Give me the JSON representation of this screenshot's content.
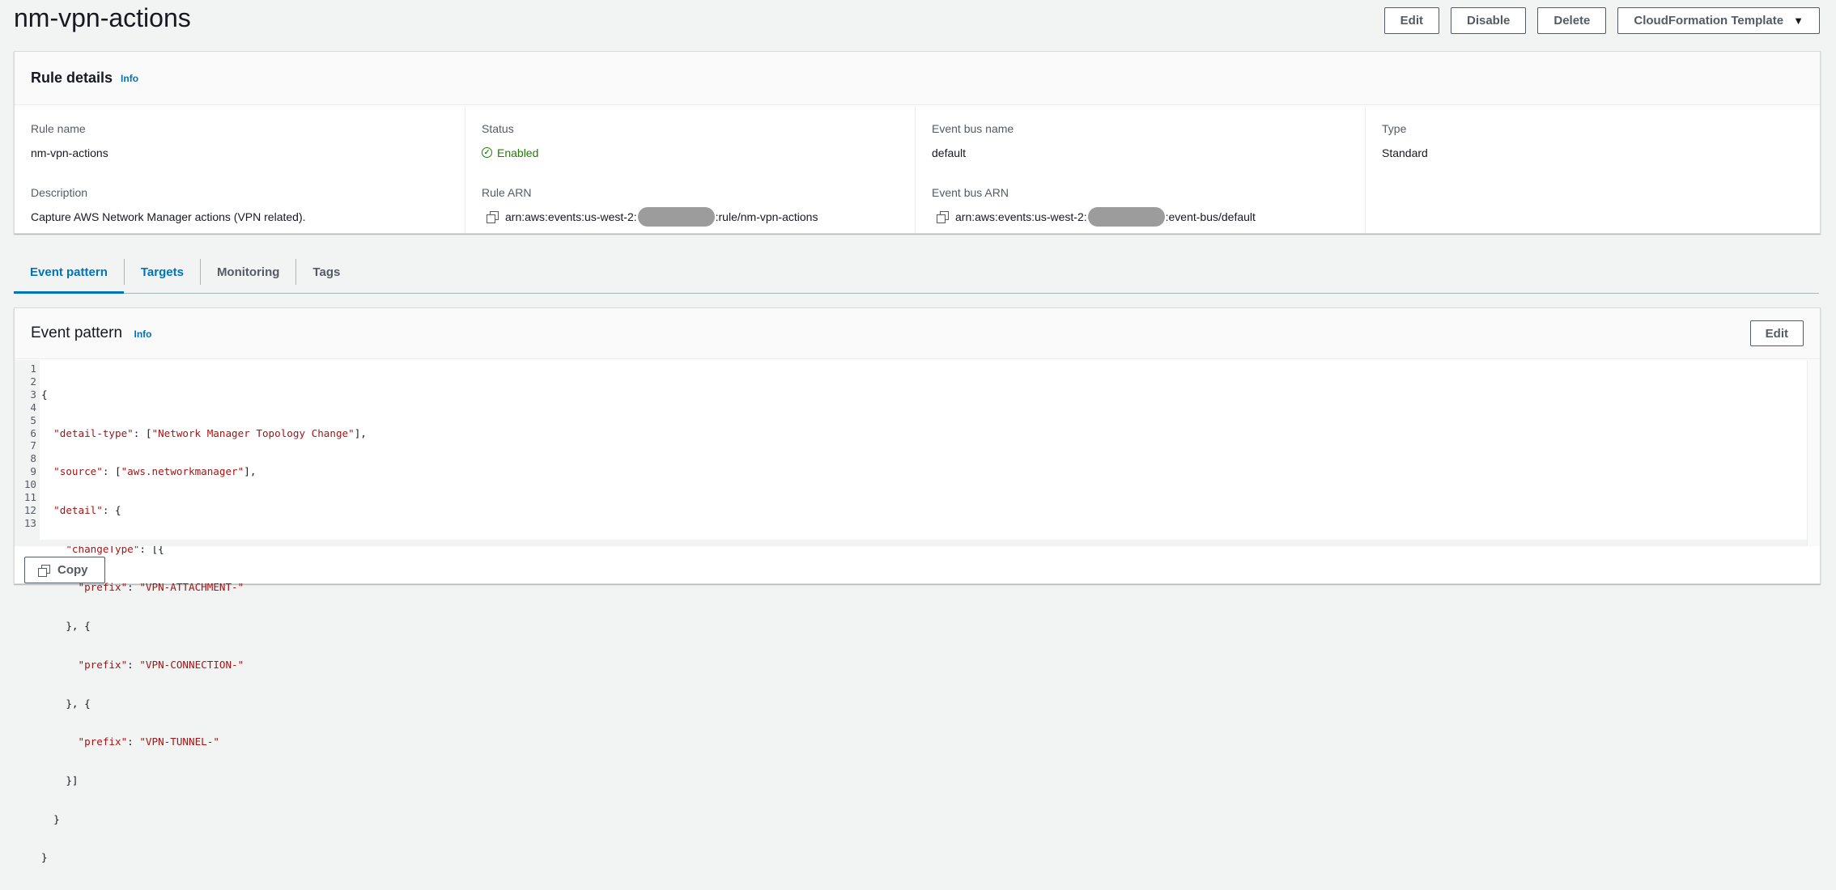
{
  "page": {
    "title": "nm-vpn-actions",
    "actions": {
      "edit": "Edit",
      "disable": "Disable",
      "delete": "Delete",
      "cloudformation": "CloudFormation Template"
    }
  },
  "rule_details": {
    "title": "Rule details",
    "info": "Info",
    "rule_name_label": "Rule name",
    "rule_name": "nm-vpn-actions",
    "description_label": "Description",
    "description": "Capture AWS Network Manager actions (VPN related).",
    "status_label": "Status",
    "status": "Enabled",
    "rule_arn_label": "Rule ARN",
    "rule_arn_prefix": "arn:aws:events:us-west-2:",
    "rule_arn_suffix": ":rule/nm-vpn-actions",
    "event_bus_name_label": "Event bus name",
    "event_bus_name": "default",
    "event_bus_arn_label": "Event bus ARN",
    "event_bus_arn_prefix": "arn:aws:events:us-west-2:",
    "event_bus_arn_suffix": ":event-bus/default",
    "type_label": "Type",
    "type": "Standard"
  },
  "tabs": [
    "Event pattern",
    "Targets",
    "Monitoring",
    "Tags"
  ],
  "event_pattern": {
    "title": "Event pattern",
    "info": "Info",
    "edit": "Edit",
    "copy": "Copy",
    "line_numbers": [
      "1",
      "2",
      "3",
      "4",
      "5",
      "6",
      "7",
      "8",
      "9",
      "10",
      "11",
      "12",
      "13"
    ],
    "code": {
      "l1": "{",
      "l2_key": "  \"detail-type\"",
      "l2_open": ": [",
      "l2_val": "\"Network Manager Topology Change\"",
      "l2_close": "],",
      "l3_key": "  \"source\"",
      "l3_open": ": [",
      "l3_val": "\"aws.networkmanager\"",
      "l3_close": "],",
      "l4_key": "  \"detail\"",
      "l4_rest": ": {",
      "l5_key": "    \"changeType\"",
      "l5_rest": ": [{",
      "l6_key": "      \"prefix\"",
      "l6_sep": ": ",
      "l6_val": "\"VPN-ATTACHMENT-\"",
      "l7": "    }, {",
      "l8_key": "      \"prefix\"",
      "l8_sep": ": ",
      "l8_val": "\"VPN-CONNECTION-\"",
      "l9": "    }, {",
      "l10_key": "      \"prefix\"",
      "l10_sep": ": ",
      "l10_val": "\"VPN-TUNNEL-\"",
      "l11": "    }]",
      "l12": "  }",
      "l13": "}"
    }
  }
}
